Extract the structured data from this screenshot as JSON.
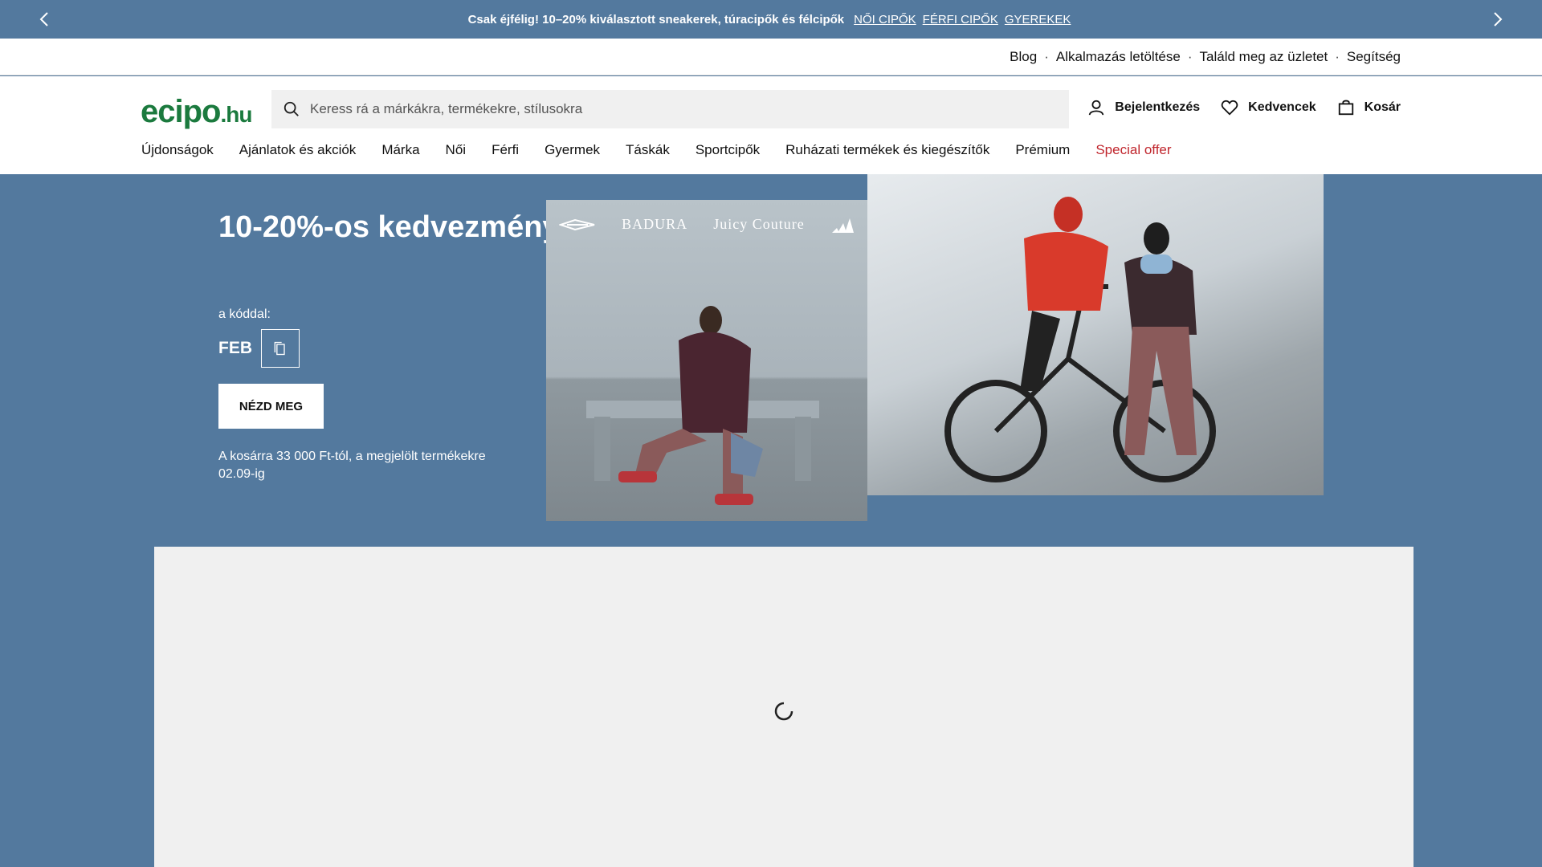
{
  "promo": {
    "message": "Csak éjfélig! 10–20% kiválasztott sneakerek, túracipők és félcipők",
    "links": [
      "NŐI CIPŐK",
      "FÉRFI CIPŐK",
      "GYEREKEK"
    ],
    "prev_icon": "chevron-left-icon",
    "next_icon": "chevron-right-icon"
  },
  "utility": {
    "links": [
      "Blog",
      "Alkalmazás letöltése",
      "Találd meg az üzletet",
      "Segítség"
    ],
    "separator": "·"
  },
  "header": {
    "logo_main": "ecipo",
    "logo_tld": ".hu",
    "search_placeholder": "Keress rá a márkákra, termékekre, stílusokra",
    "login_label": "Bejelentkezés",
    "favorites_label": "Kedvencek",
    "cart_label": "Kosár"
  },
  "nav": {
    "items": [
      "Újdonságok",
      "Ajánlatok és akciók",
      "Márka",
      "Női",
      "Férfi",
      "Gyermek",
      "Táskák",
      "Sportcipők",
      "Ruházati termékek és kiegészítők",
      "Prémium"
    ],
    "special": "Special offer"
  },
  "hero": {
    "title": "10-20%-os kedvezmények",
    "code_label": "a kóddal:",
    "code": "FEB",
    "cta": "NÉZD MEG",
    "terms": "A kosárra 33 000 Ft-tól, a megjelölt termékekre 02.09-ig",
    "brands": [
      "BADURA",
      "Juicy Couture"
    ]
  },
  "colors": {
    "accent_bg": "#53799e",
    "logo_green": "#1b7a3e",
    "special_red": "#c0262d"
  }
}
